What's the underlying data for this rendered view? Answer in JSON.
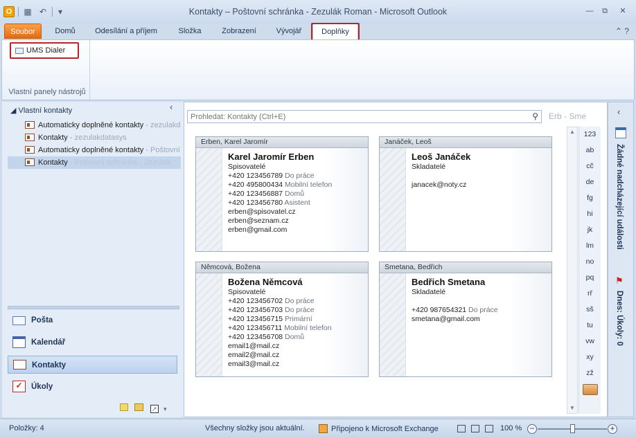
{
  "window": {
    "title": "Kontakty – Poštovní schránka - Zezulák Roman  -  Microsoft Outlook",
    "app_icon": "O",
    "controls": [
      "—",
      "⧉",
      "✕"
    ]
  },
  "ribbon": {
    "tabs": [
      "Soubor",
      "Domů",
      "Odesílání a příjem",
      "Složka",
      "Zobrazení",
      "Vývojář",
      "Doplňky"
    ],
    "active_tab": "Doplňky",
    "highlight_color": "#b1262b",
    "ums_button": "UMS Dialer",
    "group_label": "Vlastní panely nástrojů"
  },
  "navpane": {
    "header": "Vlastní kontakty",
    "folders": [
      {
        "name": "Automaticky doplněné kontakty",
        "sub": " - zezulakdatasys"
      },
      {
        "name": "Kontakty",
        "sub": " - zezulakdatasys"
      },
      {
        "name": "Automaticky doplněné kontakty",
        "sub": " - Poštovní schránka"
      },
      {
        "name": "Kontakty",
        "sub": " - Poštovní schránka - Zezulák"
      }
    ],
    "selected_folder": 3,
    "nav_buttons": [
      {
        "label": "Pošta",
        "icon": "mail-icon"
      },
      {
        "label": "Kalendář",
        "icon": "calendar-icon"
      },
      {
        "label": "Kontakty",
        "icon": "contacts-icon"
      },
      {
        "label": "Úkoly",
        "icon": "tasks-icon"
      }
    ],
    "active_nav": "Kontakty"
  },
  "search": {
    "placeholder": "Prohledat: Kontakty (Ctrl+E)",
    "range_label": "Erb - Sme"
  },
  "contacts": [
    {
      "file_as": "Erben, Karel Jaromír",
      "full_name": "Karel Jaromír Erben",
      "company": "Spisovatelé",
      "lines": [
        {
          "v": "+420 123456789",
          "l": " Do práce"
        },
        {
          "v": "+420 495800434",
          "l": " Mobilní telefon"
        },
        {
          "v": "+420 123456887",
          "l": " Domů"
        },
        {
          "v": "+420 123456780",
          "l": " Asistent"
        },
        {
          "v": "erben@spisovatel.cz",
          "l": ""
        },
        {
          "v": "erben@seznam.cz",
          "l": ""
        },
        {
          "v": "erben@gmail.com",
          "l": ""
        }
      ]
    },
    {
      "file_as": "Janáček, Leoš",
      "full_name": "Leoš Janáček",
      "company": "Skladatelé",
      "gap": true,
      "lines": [
        {
          "v": "janacek@noty.cz",
          "l": ""
        }
      ]
    },
    {
      "file_as": "Němcová, Božena",
      "full_name": "Božena Němcová",
      "company": "Spisovatelé",
      "lines": [
        {
          "v": "+420 123456702",
          "l": " Do práce"
        },
        {
          "v": "+420 123456703",
          "l": " Do práce"
        },
        {
          "v": "+420 123456715",
          "l": " Primární"
        },
        {
          "v": "+420 123456711",
          "l": " Mobilní telefon"
        },
        {
          "v": "+420 123456708",
          "l": " Domů"
        },
        {
          "v": "email1@mail.cz",
          "l": ""
        },
        {
          "v": "email2@mail.cz",
          "l": ""
        },
        {
          "v": "email3@mail.cz",
          "l": ""
        }
      ]
    },
    {
      "file_as": "Smetana, Bedřich",
      "full_name": "Bedřich Smetana",
      "company": "Skladatelé",
      "gap": true,
      "lines": [
        {
          "v": "+420 987654321",
          "l": " Do práce"
        },
        {
          "v": "smetana@gmail.com",
          "l": ""
        }
      ]
    }
  ],
  "index_letters": [
    "123",
    "ab",
    "cč",
    "de",
    "fg",
    "hi",
    "jk",
    "lm",
    "no",
    "pq",
    "rř",
    "sš",
    "tu",
    "vw",
    "xy",
    "zž"
  ],
  "todobar": {
    "appointments": "Žádné nadcházející události",
    "tasks": "Dnes: Úkoly: 0"
  },
  "status": {
    "items": "Položky: 4",
    "sync": "Všechny složky jsou aktuální.",
    "exchange": "Připojeno k Microsoft Exchange",
    "zoom": "100 %"
  }
}
